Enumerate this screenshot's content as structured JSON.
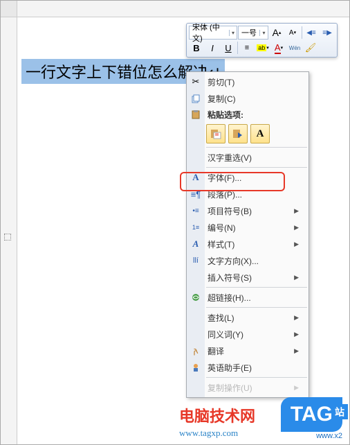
{
  "document": {
    "selected_text": "一行文字上下错位怎么解决",
    "paragraph_mark": "↵"
  },
  "mini_toolbar": {
    "font_name": "宋体 (中文)",
    "font_size": "一号",
    "grow_font": "A",
    "shrink_font": "A",
    "decrease_indent": "←≡",
    "increase_indent": "≡→",
    "bold": "B",
    "italic": "I",
    "underline": "U",
    "center": "≡",
    "highlight": "ab",
    "font_color": "A",
    "phonetic": "Wén",
    "format_painter": "✎"
  },
  "menu": {
    "cut": "剪切(T)",
    "copy": "复制(C)",
    "paste_header": "粘贴选项:",
    "reconvert": "汉字重选(V)",
    "font": "字体(F)...",
    "paragraph": "段落(P)...",
    "bullets": "项目符号(B)",
    "numbering": "编号(N)",
    "styles": "样式(T)",
    "text_direction": "文字方向(X)...",
    "insert_symbol": "插入符号(S)",
    "hyperlink": "超链接(H)...",
    "find": "查找(L)",
    "synonyms": "同义词(Y)",
    "translate": "翻译",
    "english_assistant": "英语助手(E)",
    "other_ops": "复制操作(U)"
  },
  "watermark": {
    "title": "电脑技术网",
    "url": "www.tagxp.com",
    "tag": "TAG",
    "tag_sub": "www.x2",
    "tag_side": "站"
  },
  "colors": {
    "selection": "#9bc1e8",
    "highlight_border": "#e73828",
    "tag_bg": "#2a8be9"
  }
}
